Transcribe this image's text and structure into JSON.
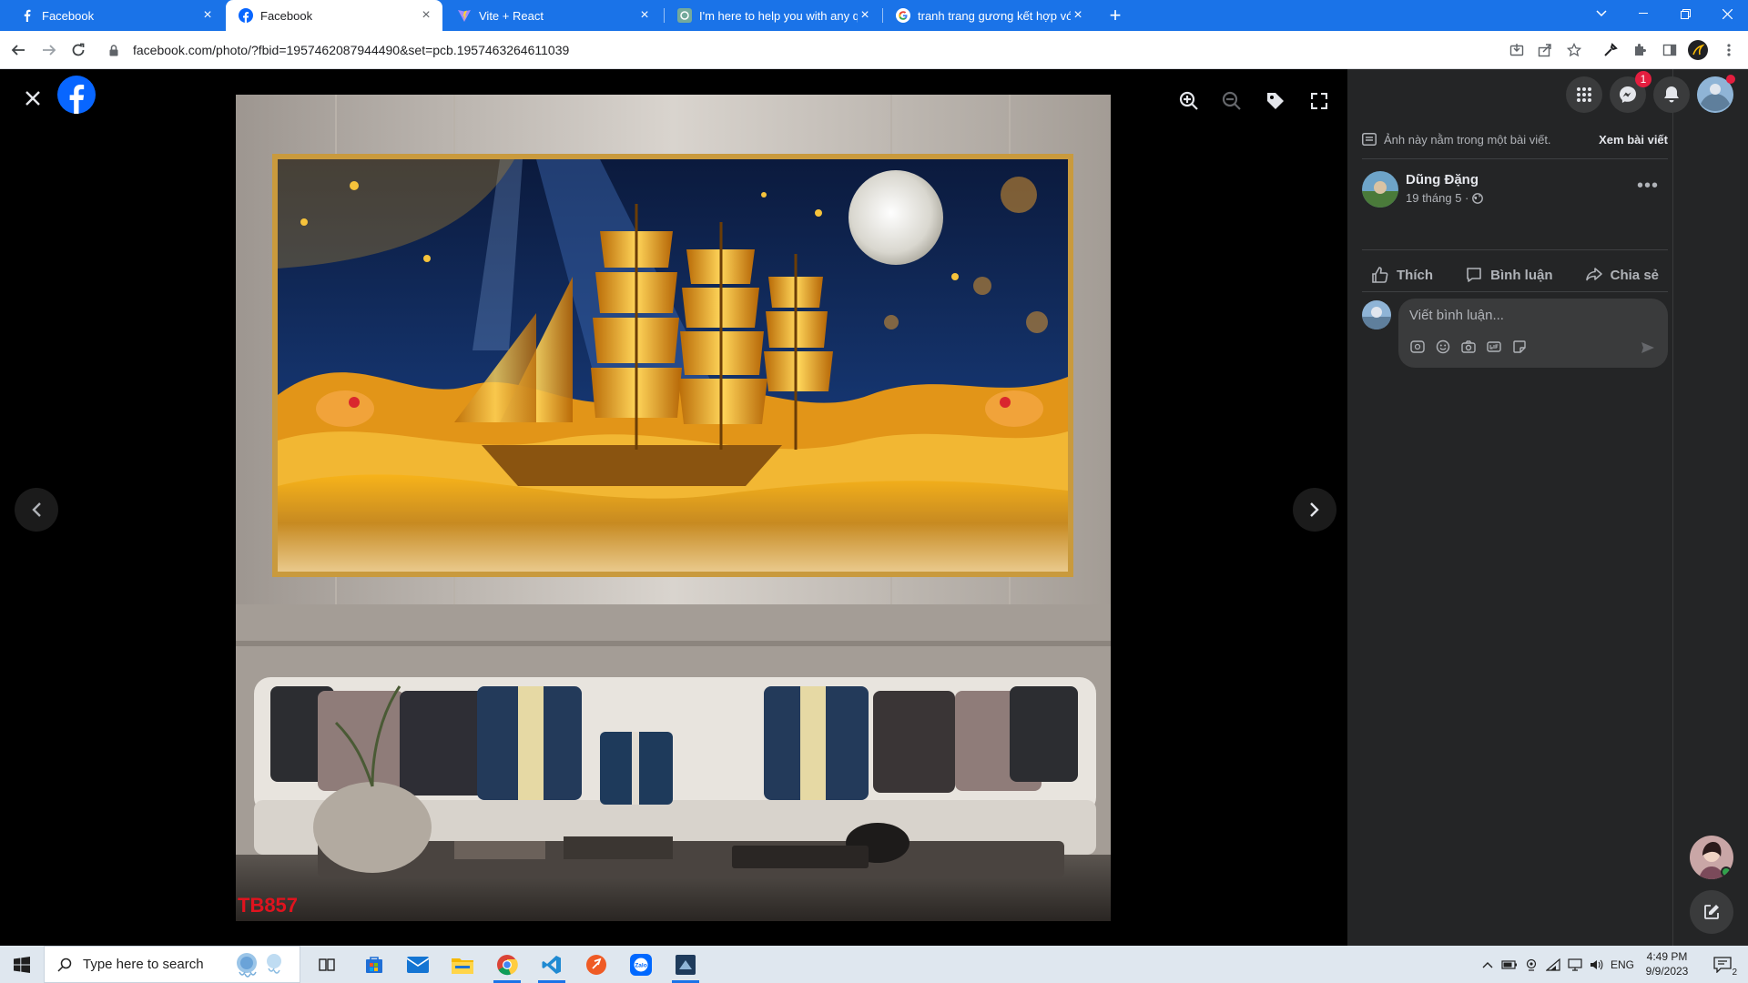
{
  "browser": {
    "tabs": [
      {
        "title": "Facebook",
        "icon": "facebook-icon",
        "active": false
      },
      {
        "title": "Facebook",
        "icon": "facebook-icon",
        "active": true
      },
      {
        "title": "Vite + React",
        "icon": "vite-icon",
        "active": false
      },
      {
        "title": "I'm here to help you with any qu",
        "icon": "chatgpt-icon",
        "active": false
      },
      {
        "title": "tranh trang gương kết hợp với m",
        "icon": "google-icon",
        "active": false
      }
    ],
    "url": "facebook.com/photo/?fbid=1957462087944490&set=pcb.1957463264611039"
  },
  "viewer": {
    "watermark": "TB857"
  },
  "sidebar": {
    "notifications_badge": "1",
    "post_info": "Ảnh này nằm trong một bài viết.",
    "see_post": "Xem bài viết",
    "author_name": "Dũng Đặng",
    "post_date": "19 tháng 5 ·",
    "actions": {
      "like": "Thích",
      "comment": "Bình luận",
      "share": "Chia sẻ"
    },
    "comment_placeholder": "Viết bình luận..."
  },
  "taskbar": {
    "search_placeholder": "Type here to search",
    "language": "ENG",
    "time": "4:49 PM",
    "date": "9/9/2023",
    "notification_count": "2"
  },
  "colors": {
    "chrome_blue": "#1a73e8",
    "facebook_blue": "#0866ff",
    "panel_bg": "#242526"
  }
}
